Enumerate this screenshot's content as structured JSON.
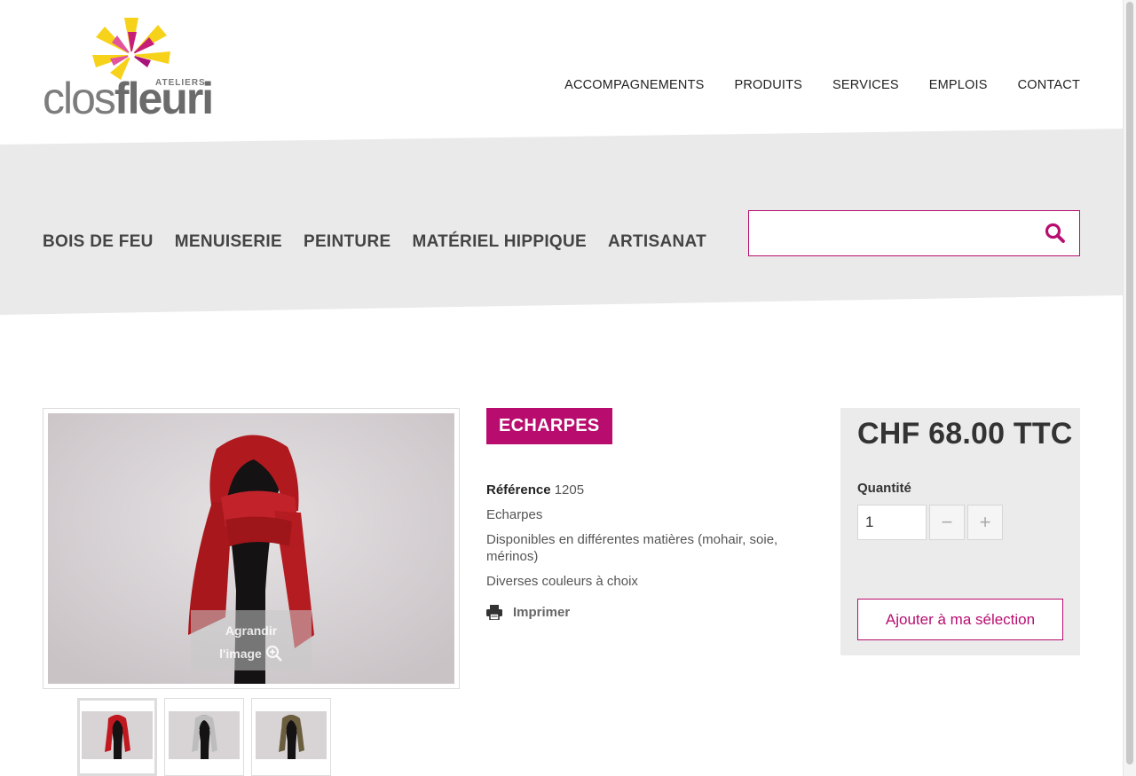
{
  "brand": {
    "small": "ATELIERS",
    "part1": "clos",
    "part2": "fleuri"
  },
  "topnav": [
    "ACCOMPAGNEMENTS",
    "PRODUITS",
    "SERVICES",
    "EMPLOIS",
    "CONTACT"
  ],
  "catnav": [
    "BOIS DE FEU",
    "MENUISERIE",
    "PEINTURE",
    "MATÉRIEL HIPPIQUE",
    "ARTISANAT"
  ],
  "search": {
    "placeholder": "",
    "value": "",
    "icon": "search-icon"
  },
  "product": {
    "category": "ECHARPES",
    "reference_label": "Référence",
    "reference_value": "1205",
    "name": "Echarpes",
    "description": "Disponibles en différentes matières (mohair, soie, mérinos)",
    "colors": "Diverses couleurs à choix",
    "print_label": "Imprimer",
    "zoom_line1": "Agrandir",
    "zoom_line2": "l'image"
  },
  "thumbnails": [
    {
      "scarf_color": "#c0181e",
      "active": true
    },
    {
      "scarf_color": "#bdbdbd",
      "active": false
    },
    {
      "scarf_color": "#6b5e3f",
      "active": false
    }
  ],
  "purchase": {
    "price": "CHF 68.00 TTC",
    "quantity_label": "Quantité",
    "quantity_value": "1",
    "minus_label": "−",
    "plus_label": "+",
    "add_label": "Ajouter à ma sélection"
  },
  "colors": {
    "accent": "#b80d6f",
    "band": "#eaeaea",
    "price_box": "#ebebeb"
  }
}
